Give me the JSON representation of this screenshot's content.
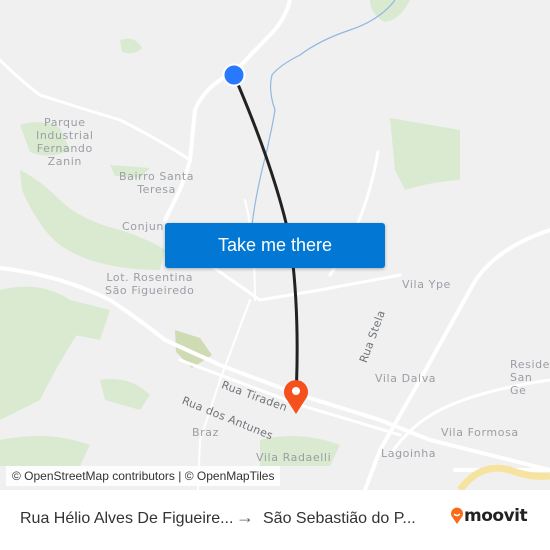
{
  "map": {
    "labels": [
      {
        "id": "parque-industrial",
        "text": "Parque\nIndustrial\nFernando\nZanin"
      },
      {
        "id": "bairro-santa-teresa",
        "text": "Bairro Santa\nTeresa"
      },
      {
        "id": "conjunto",
        "text": "Conjun"
      },
      {
        "id": "lot-rosentina",
        "text": "Lot. Rosentina\nSão Figueiredo"
      },
      {
        "id": "vila-ype",
        "text": "Vila Ype"
      },
      {
        "id": "rua-stela",
        "text": "Rua Stela"
      },
      {
        "id": "vila-dalva",
        "text": "Vila Dalva"
      },
      {
        "id": "residencial",
        "text": "Reside\nSan Ge"
      },
      {
        "id": "rua-tiradentes",
        "text": "Rua Tiraden"
      },
      {
        "id": "rua-dos-antunes",
        "text": "Rua dos Antunes"
      },
      {
        "id": "braz",
        "text": "Braz"
      },
      {
        "id": "vila-formosa",
        "text": "Vila Formosa"
      },
      {
        "id": "vila-radaelli",
        "text": "Vila Radaelli"
      },
      {
        "id": "lagoinha",
        "text": "Lagoinha"
      }
    ],
    "origin_marker": {
      "icon": "origin-dot-icon",
      "color": "#2979ff"
    },
    "destination_marker": {
      "icon": "destination-pin-icon",
      "color": "#f4511e"
    },
    "route_color": "#222222",
    "cta_label": "Take me there",
    "attribution": "© OpenStreetMap contributors | © OpenMapTiles"
  },
  "footer": {
    "from": "Rua Hélio Alves De Figueire...",
    "arrow_icon": "arrow-right-icon",
    "to": "São Sebastião do P...",
    "brand": "moovit",
    "brand_color": "#f96b1a"
  }
}
